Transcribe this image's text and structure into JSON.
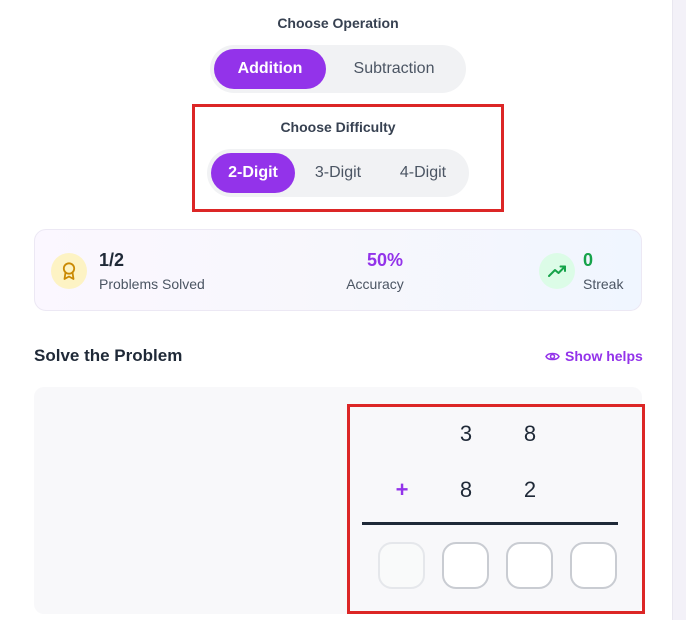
{
  "operation": {
    "label": "Choose Operation",
    "options": [
      "Addition",
      "Subtraction"
    ],
    "selected": "Addition"
  },
  "difficulty": {
    "label": "Choose Difficulty",
    "options": [
      "2-Digit",
      "3-Digit",
      "4-Digit"
    ],
    "selected": "2-Digit"
  },
  "stats": {
    "solved_value": "1/2",
    "solved_label": "Problems Solved",
    "accuracy_value": "50%",
    "accuracy_label": "Accuracy",
    "streak_value": "0",
    "streak_label": "Streak"
  },
  "problem": {
    "title": "Solve the Problem",
    "show_helps": "Show helps",
    "top_digits": [
      "3",
      "8"
    ],
    "operator": "+",
    "bottom_digits": [
      "8",
      "2"
    ],
    "answer_boxes": 4
  },
  "colors": {
    "accent": "#9333ea",
    "streak": "#16a34a",
    "highlight": "#dc2626"
  }
}
